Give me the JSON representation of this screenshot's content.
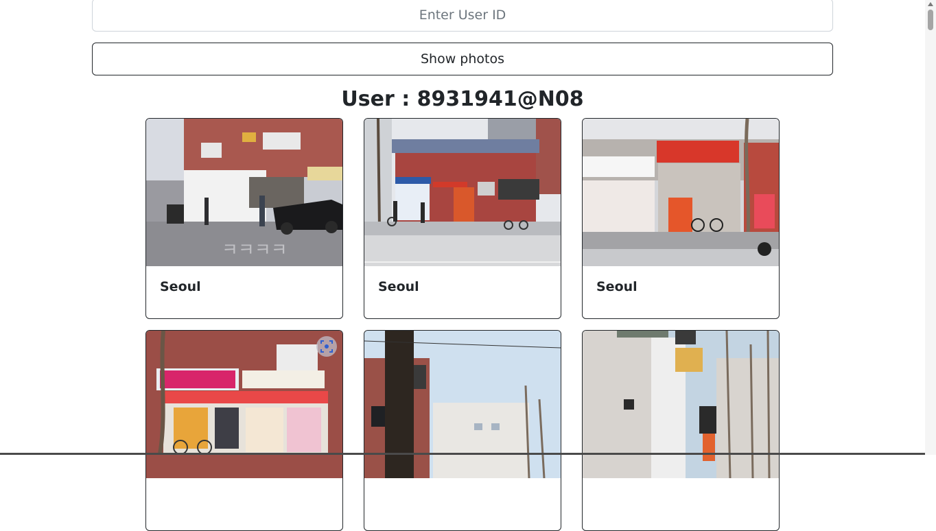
{
  "form": {
    "user_id_placeholder": "Enter User ID",
    "user_id_value": "",
    "show_button_label": "Show photos"
  },
  "heading": "User : 8931941@N08",
  "cards": [
    {
      "title": "Seoul"
    },
    {
      "title": "Seoul"
    },
    {
      "title": "Seoul"
    },
    {
      "title": ""
    },
    {
      "title": ""
    },
    {
      "title": ""
    }
  ],
  "icons": {
    "visual_search": "visual-search-icon"
  },
  "colors": {
    "text": "#212529",
    "border": "#212529",
    "input_border": "#ced4da",
    "placeholder": "#6c757d"
  }
}
